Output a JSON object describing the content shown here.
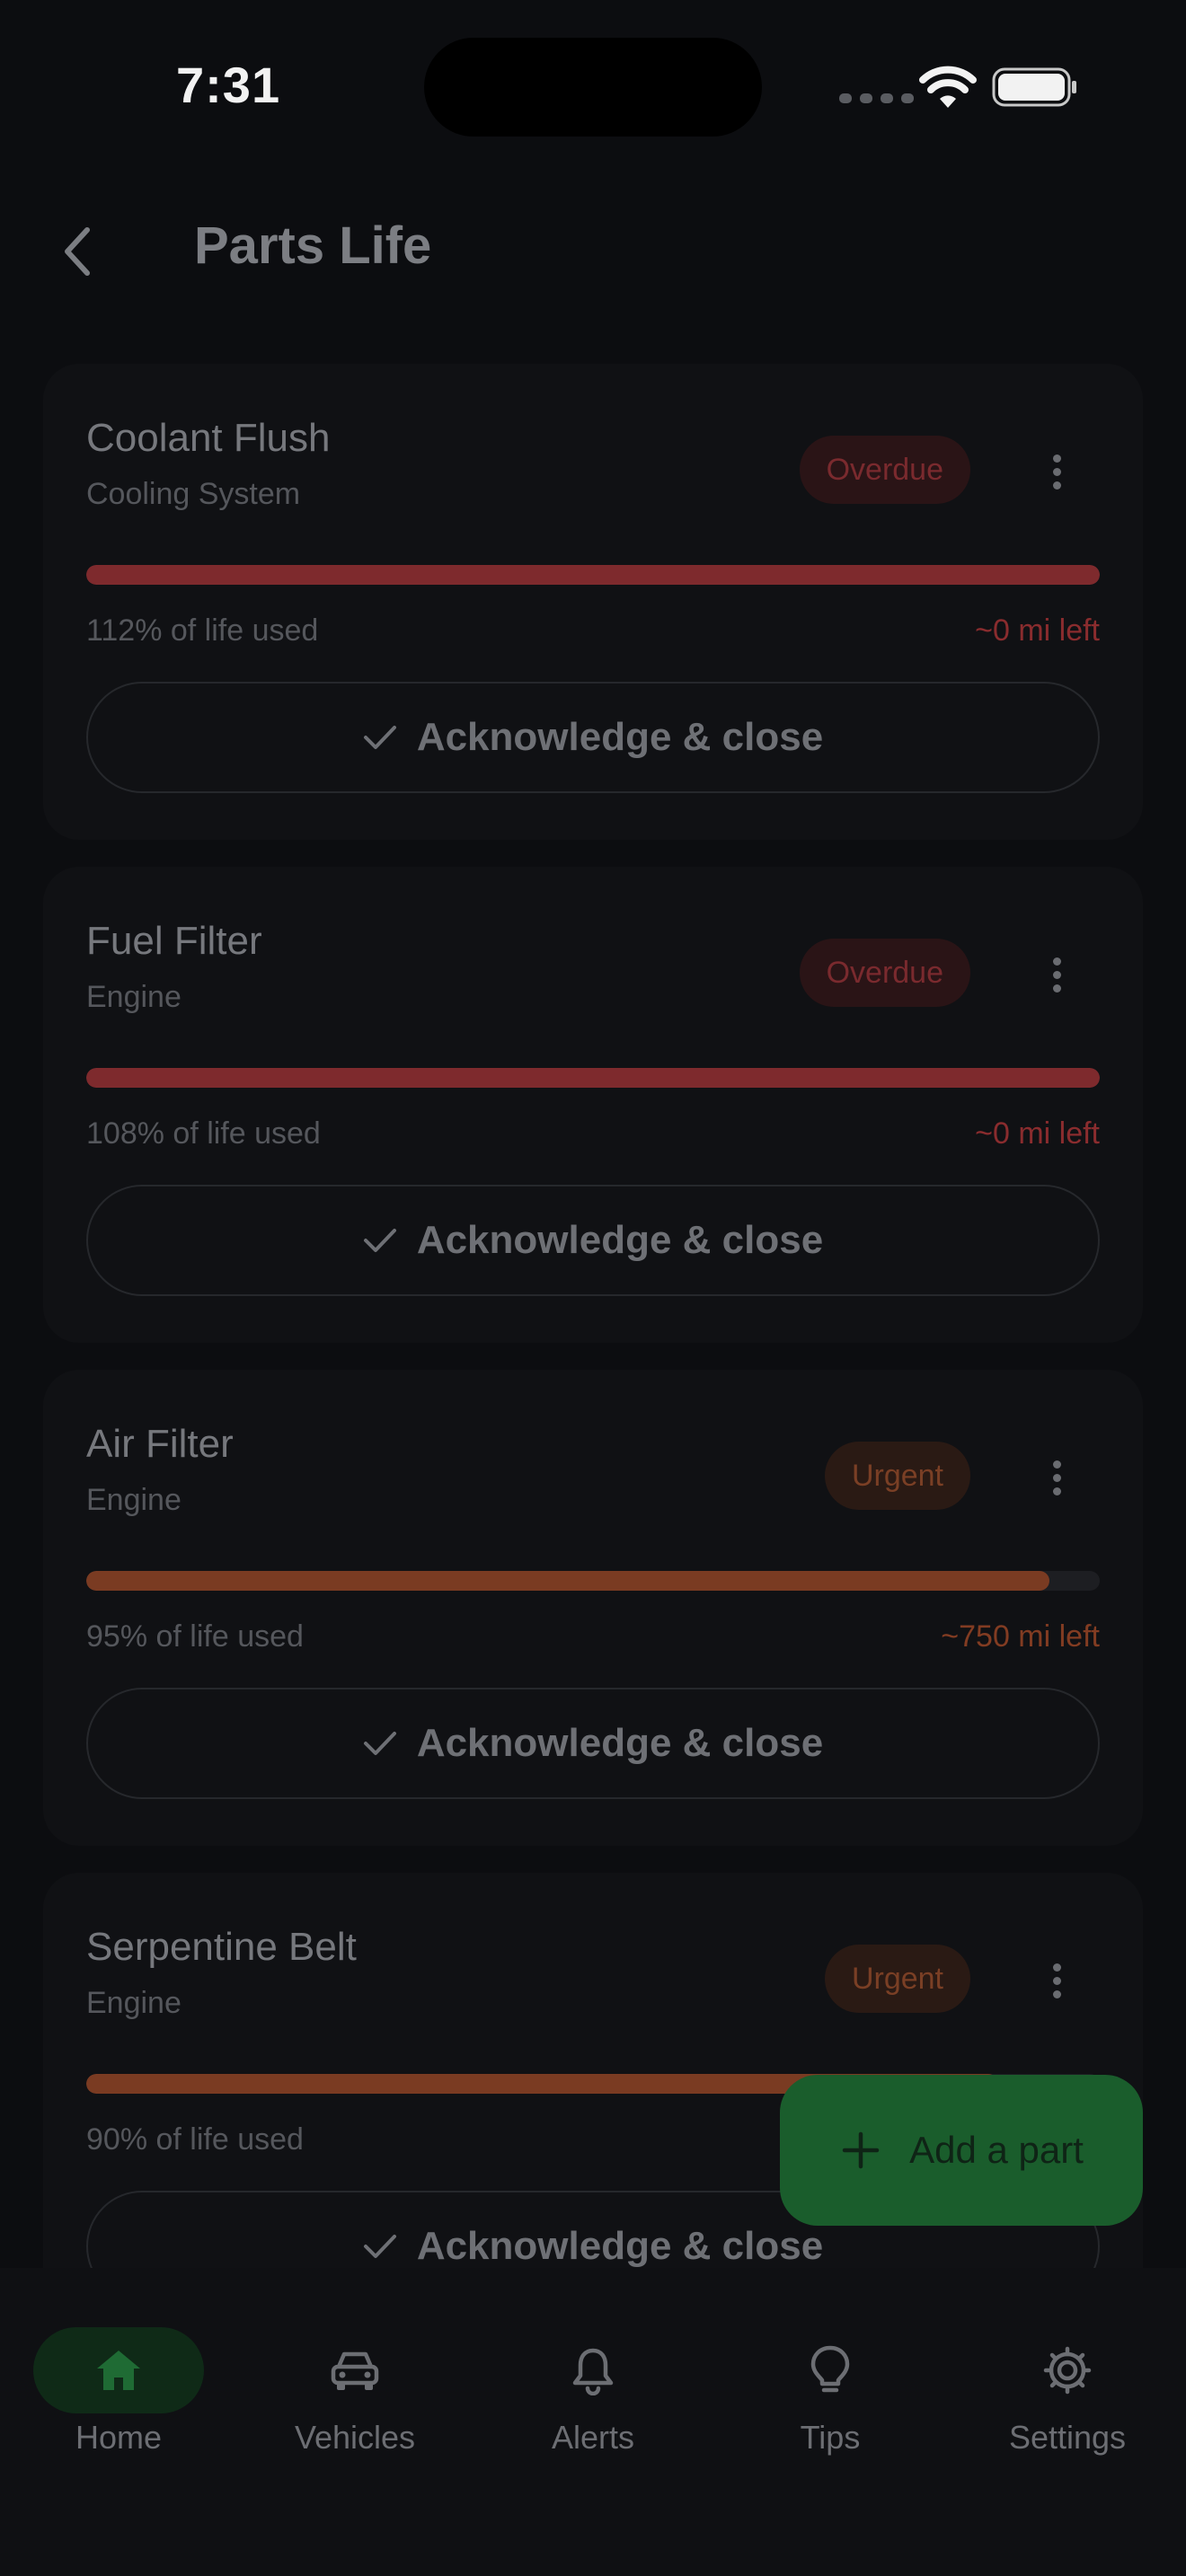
{
  "status_bar": {
    "time": "7:31"
  },
  "header": {
    "title": "Parts Life"
  },
  "parts": [
    {
      "name": "Coolant Flush",
      "system": "Cooling System",
      "badge": "Overdue",
      "badge_type": "overdue",
      "life_used_fraction": 1.0,
      "life_used_text": "112% of life used",
      "miles_left": "~0 mi left",
      "bar_color": "#7e2a2d",
      "miles_color": "#8a2c2e",
      "action_label": "Acknowledge & close"
    },
    {
      "name": "Fuel Filter",
      "system": "Engine",
      "badge": "Overdue",
      "badge_type": "overdue",
      "life_used_fraction": 1.0,
      "life_used_text": "108% of life used",
      "miles_left": "~0 mi left",
      "bar_color": "#7e2a2d",
      "miles_color": "#8a2c2e",
      "action_label": "Acknowledge & close"
    },
    {
      "name": "Air Filter",
      "system": "Engine",
      "badge": "Urgent",
      "badge_type": "urgent",
      "life_used_fraction": 0.95,
      "life_used_text": "95% of life used",
      "miles_left": "~750 mi left",
      "bar_color": "#7a3b22",
      "miles_color": "#823c22",
      "action_label": "Acknowledge & close"
    },
    {
      "name": "Serpentine Belt",
      "system": "Engine",
      "badge": "Urgent",
      "badge_type": "urgent",
      "life_used_fraction": 0.9,
      "life_used_text": "90% of life used",
      "miles_left": "",
      "bar_color": "#7a3b22",
      "miles_color": "#823c22",
      "action_label": "Acknowledge & close"
    }
  ],
  "fab": {
    "label": "Add a part"
  },
  "nav": {
    "items": [
      {
        "label": "Home",
        "icon": "home-icon",
        "active": true
      },
      {
        "label": "Vehicles",
        "icon": "car-icon",
        "active": false
      },
      {
        "label": "Alerts",
        "icon": "bell-icon",
        "active": false
      },
      {
        "label": "Tips",
        "icon": "lightbulb-icon",
        "active": false
      },
      {
        "label": "Settings",
        "icon": "gear-icon",
        "active": false
      }
    ]
  },
  "colors": {
    "accent": "#1a5d2c",
    "overdue": "#7e2a2d",
    "urgent": "#7a3b22",
    "background": "#0c0d10"
  }
}
